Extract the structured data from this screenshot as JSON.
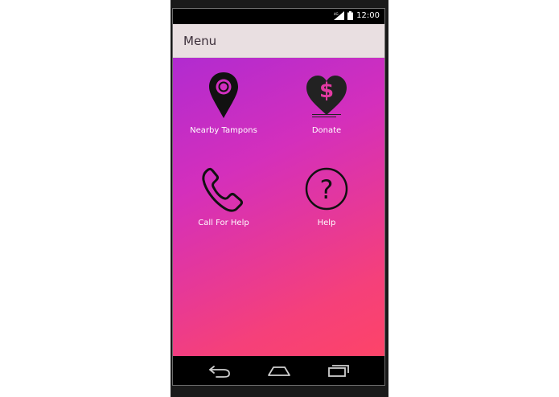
{
  "status_bar": {
    "time": "12:00"
  },
  "app_bar": {
    "title": "Menu"
  },
  "menu": {
    "items": [
      {
        "label": "Nearby Tampons",
        "icon": "map-pin-icon"
      },
      {
        "label": "Donate",
        "icon": "heart-dollar-icon"
      },
      {
        "label": "Call For Help",
        "icon": "phone-icon"
      },
      {
        "label": "Help",
        "icon": "question-circle-icon"
      }
    ]
  },
  "navigation_bar": {
    "buttons": [
      {
        "icon": "back-icon"
      },
      {
        "icon": "home-icon"
      },
      {
        "icon": "recents-icon"
      }
    ]
  },
  "colors": {
    "gradient_start": "#b12bd0",
    "gradient_end": "#fd4468",
    "app_bar": "#e9dfe1"
  }
}
